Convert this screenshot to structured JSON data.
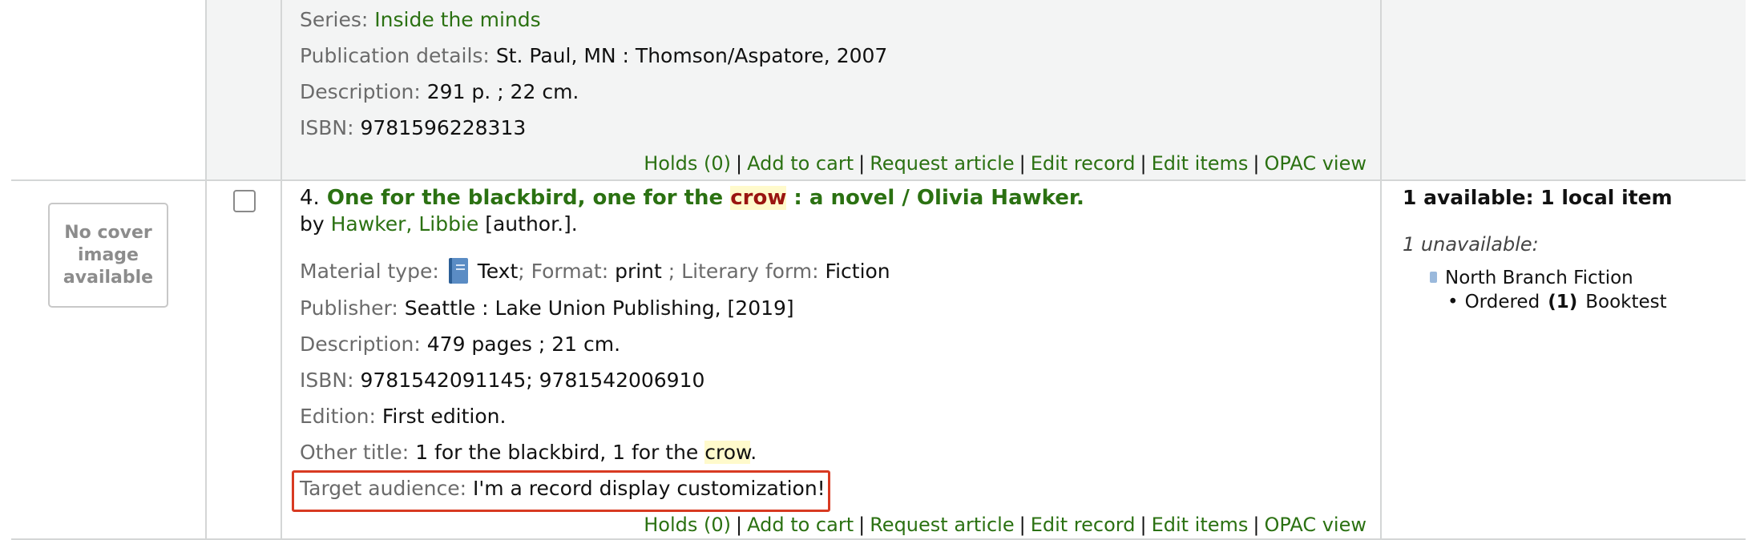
{
  "prev_record": {
    "series_label": "Series:",
    "series_value": "Inside the minds",
    "pub_label": "Publication details:",
    "pub_value": "St. Paul, MN : Thomson/Aspatore, 2007",
    "desc_label": "Description:",
    "desc_value": "291 p. ; 22 cm.",
    "isbn_label": "ISBN:",
    "isbn_value": "9781596228313",
    "actions": [
      "Holds (0)",
      "Add to cart",
      "Request article",
      "Edit record",
      "Edit items",
      "OPAC view"
    ]
  },
  "record": {
    "number": "4.",
    "title_before": "One for the blackbird, one for the ",
    "title_highlight": "crow",
    "title_after": " : a novel / Olivia Hawker.",
    "by_prefix": "by",
    "author": "Hawker, Libbie",
    "author_role": "[author.].",
    "cover_text": "No cover image available",
    "material_label": "Material type:",
    "material_value": "Text",
    "format_label": "; Format:",
    "format_value": "print",
    "literary_label": "; Literary form:",
    "literary_value": "Fiction",
    "publisher_label": "Publisher:",
    "publisher_value": "Seattle : Lake Union Publishing, [2019]",
    "desc_label": "Description:",
    "desc_value": "479 pages ; 21 cm.",
    "isbn_label": "ISBN:",
    "isbn_value": "9781542091145; 9781542006910",
    "edition_label": "Edition:",
    "edition_value": "First edition.",
    "other_label": "Other title:",
    "other_value_before": "1 for the blackbird, 1 for the ",
    "other_value_highlight": "crow",
    "other_value_after": ".",
    "audience_label": "Target audience:",
    "audience_value": "I'm a record display customization!",
    "actions": [
      "Holds (0)",
      "Add to cart",
      "Request article",
      "Edit record",
      "Edit items",
      "OPAC view"
    ]
  },
  "availability": {
    "available": "1 available: 1 local item",
    "unavailable": "1 unavailable:",
    "branch": "North Branch Fiction",
    "status": "Ordered",
    "count": "(1)",
    "location": "Booktest"
  },
  "colors": {
    "link": "#2b7112",
    "highlight_bg": "#fffacc",
    "target_box_border": "#d83a22"
  }
}
